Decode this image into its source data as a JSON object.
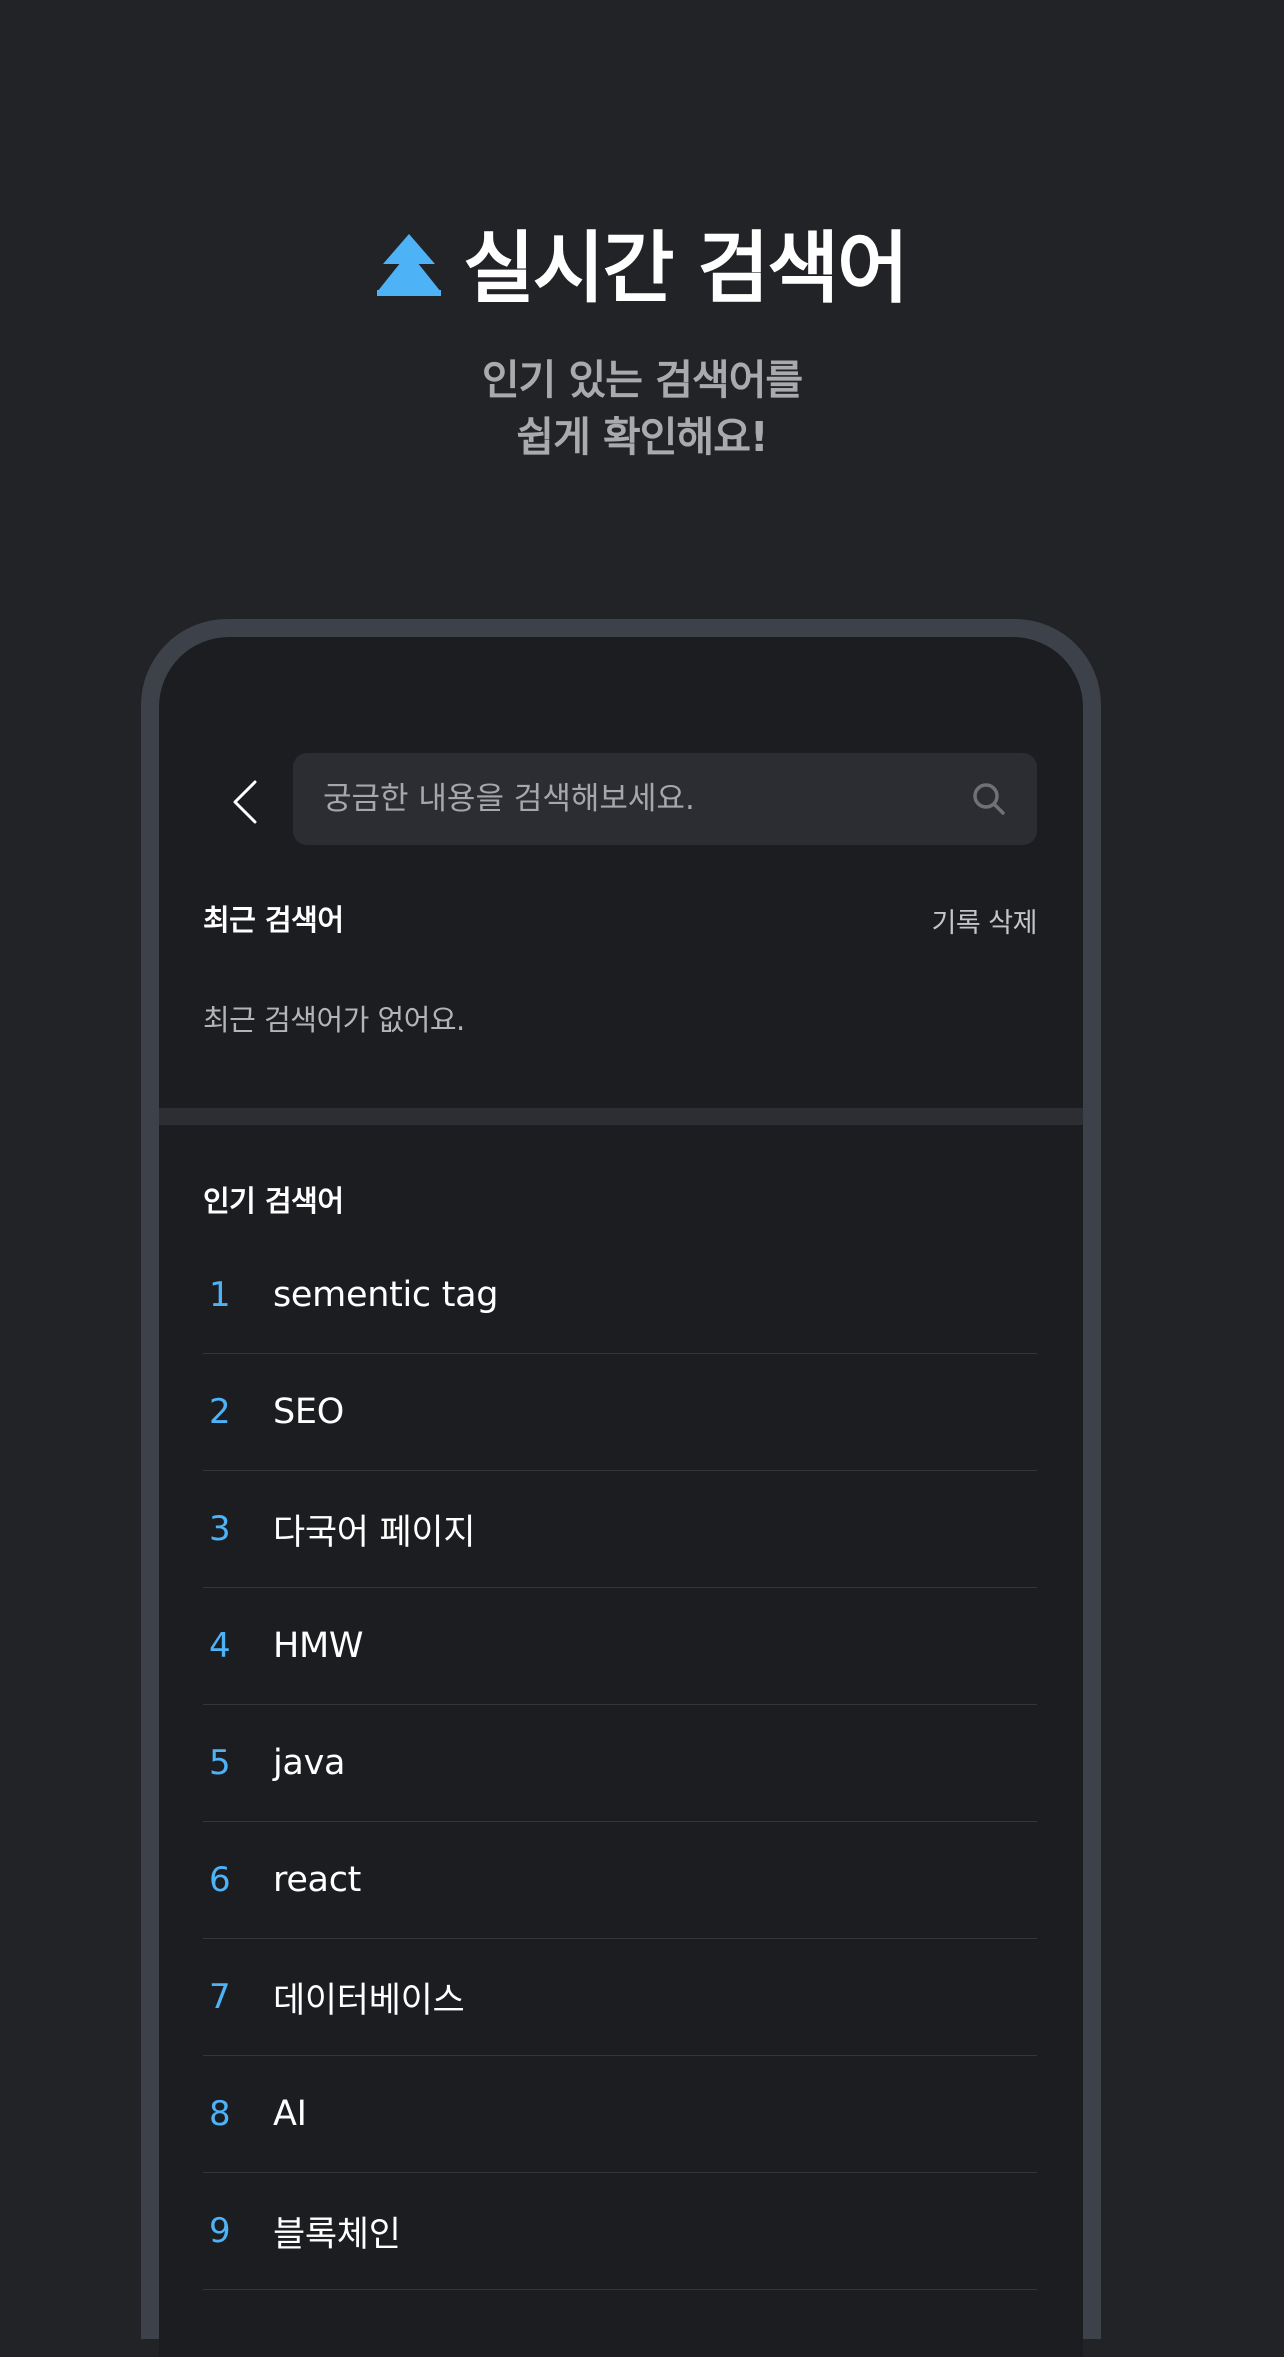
{
  "hero": {
    "icon": "double-up-arrow-icon",
    "title": "실시간 검색어",
    "subtitle_line1": "인기 있는 검색어를",
    "subtitle_line2": "쉽게 확인해요!"
  },
  "search": {
    "back_icon": "chevron-left-icon",
    "placeholder": "궁금한 내용을 검색해보세요.",
    "value": "",
    "search_icon": "search-icon"
  },
  "recent": {
    "label": "최근 검색어",
    "clear_label": "기록 삭제",
    "empty_message": "최근 검색어가 없어요."
  },
  "popular": {
    "label": "인기 검색어",
    "items": [
      {
        "rank": "1",
        "term": "sementic tag"
      },
      {
        "rank": "2",
        "term": "SEO"
      },
      {
        "rank": "3",
        "term": "다국어 페이지"
      },
      {
        "rank": "4",
        "term": "HMW"
      },
      {
        "rank": "5",
        "term": "java"
      },
      {
        "rank": "6",
        "term": "react"
      },
      {
        "rank": "7",
        "term": "데이터베이스"
      },
      {
        "rank": "8",
        "term": "AI"
      },
      {
        "rank": "9",
        "term": "블록체인"
      }
    ]
  },
  "colors": {
    "background": "#222327",
    "screen": "#1c1d21",
    "frame": "#3d414a",
    "accent": "#4db3f6",
    "search_bg": "#2c2d32"
  }
}
